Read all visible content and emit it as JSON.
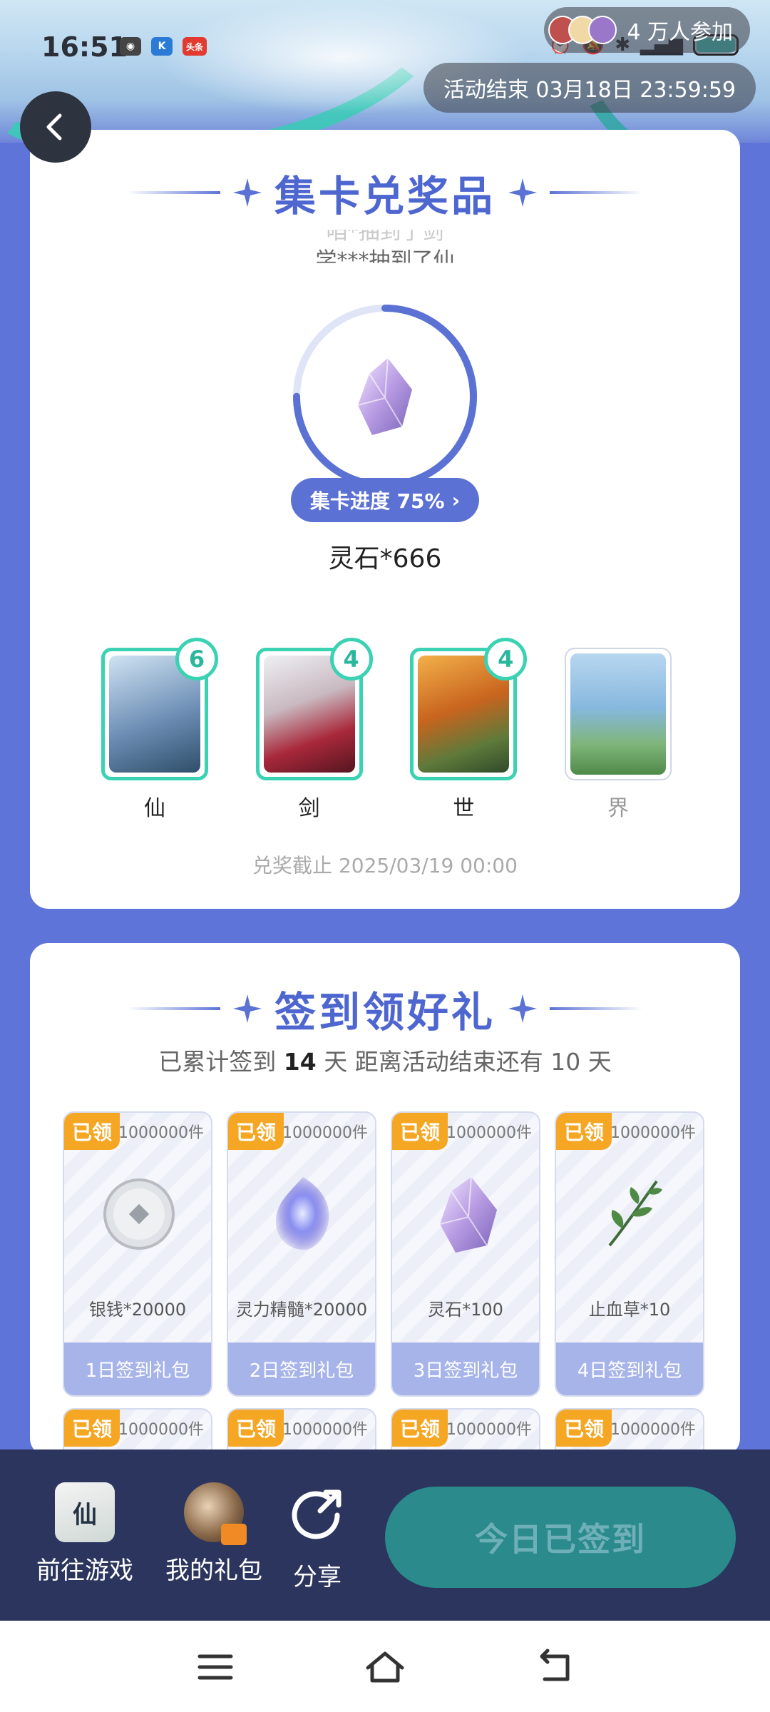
{
  "status_bar": {
    "time": "16:51",
    "app_badge": "头条"
  },
  "banner": {
    "participants": "4 万人参加",
    "countdown": "活动结束 03月18日 23:59:59"
  },
  "card_collect": {
    "title": "集卡兑奖品",
    "ticker_lines": [
      "咱*抽到了剑",
      "学***抽到了仙"
    ],
    "progress_label": "集卡进度 75%",
    "progress_percent": 75,
    "reward_name": "灵石*666",
    "cards": [
      {
        "label": "仙",
        "count": "6",
        "owned": true
      },
      {
        "label": "剑",
        "count": "4",
        "owned": true
      },
      {
        "label": "世",
        "count": "4",
        "owned": true
      },
      {
        "label": "界",
        "count": "",
        "owned": false
      }
    ],
    "deadline": "兑奖截止 2025/03/19 00:00"
  },
  "card_signin": {
    "title": "签到领好礼",
    "summary_prefix": "已累计签到",
    "summary_days": "14",
    "summary_suffix": "天  距离活动结束还有 10 天",
    "gifts": [
      {
        "badge": "已领",
        "stock": "1000000件",
        "name": "银钱*20000",
        "day": "1日签到礼包"
      },
      {
        "badge": "已领",
        "stock": "1000000件",
        "name": "灵力精髓*20000",
        "day": "2日签到礼包"
      },
      {
        "badge": "已领",
        "stock": "1000000件",
        "name": "灵石*100",
        "day": "3日签到礼包"
      },
      {
        "badge": "已领",
        "stock": "1000000件",
        "name": "止血草*10",
        "day": "4日签到礼包"
      }
    ],
    "gifts_row2": [
      {
        "badge": "已领",
        "stock": "1000000件"
      },
      {
        "badge": "已领",
        "stock": "1000000件"
      },
      {
        "badge": "已领",
        "stock": "1000000件"
      },
      {
        "badge": "已领",
        "stock": "1000000件"
      }
    ]
  },
  "action_bar": {
    "goto_game": "前往游戏",
    "my_gifts": "我的礼包",
    "share": "分享",
    "sign_button": "今日已签到"
  },
  "colors": {
    "primary": "#5b72d4",
    "accent_teal": "#3ad2b2",
    "badge_orange": "#f5a623",
    "bar_dark": "#2b355e"
  }
}
